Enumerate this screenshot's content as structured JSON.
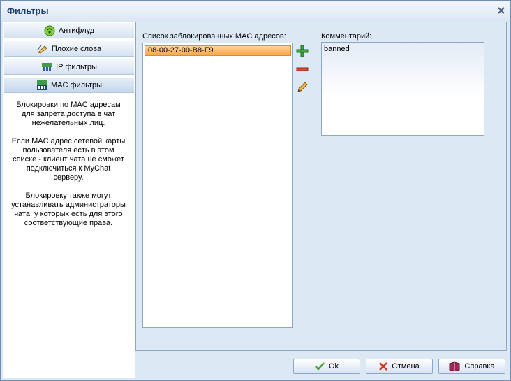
{
  "window": {
    "title": "Фильтры"
  },
  "nav": {
    "items": [
      {
        "label": "Антифлуд",
        "icon": "antiflood-icon"
      },
      {
        "label": "Плохие слова",
        "icon": "bad-words-icon"
      },
      {
        "label": "IP фильтры",
        "icon": "ip-filter-icon"
      },
      {
        "label": "MAC фильтры",
        "icon": "mac-filter-icon"
      }
    ],
    "active": "MAC фильтры"
  },
  "help_text": "Блокировки по MAC адресам\nдля запрета доступа в чат\nнежелательных лиц.\n\nЕсли MAC адрес сетевой карты\nпользователя есть в этом\nсписке - клиент чата не сможет\nподключиться к MyChat серверу.\n\nБлокировку также могут\nустанавливать администраторы\nчата, у которых есть для этого\nсоответствующие права.",
  "mac_list": {
    "label": "Список заблокированных MAC адресов:",
    "items": [
      "08-00-27-00-B8-F9"
    ]
  },
  "comment": {
    "label": "Комментарий:",
    "value": "banned"
  },
  "buttons": {
    "ok": "Ok",
    "cancel": "Отмена",
    "help": "Справка"
  },
  "colors": {
    "selection": "#f7a64b",
    "title": "#1e3f6e",
    "background": "#dde8f5"
  }
}
